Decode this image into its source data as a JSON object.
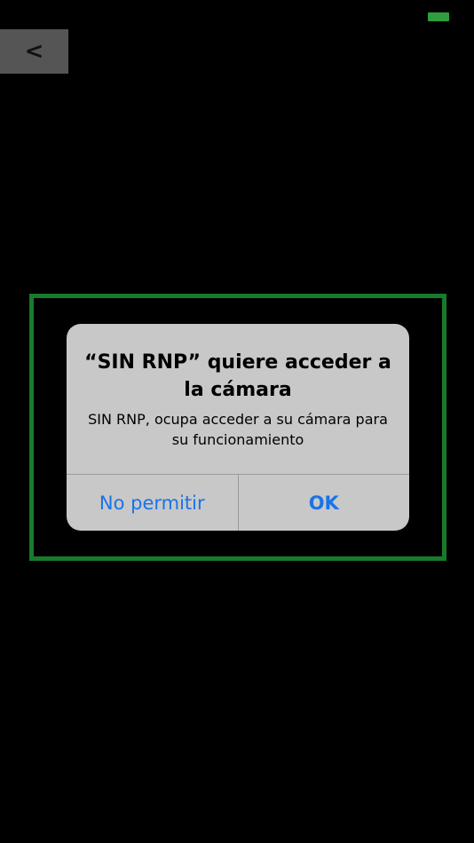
{
  "status_bar": {
    "battery_color": "#2e9e3e"
  },
  "nav": {
    "back_label": "<"
  },
  "scan_frame": {
    "color": "#1a7a2c"
  },
  "alert": {
    "title": "“SIN RNP” quiere acceder a la cámara",
    "message": "SIN RNP, ocupa acceder a su cámara para su funcionamiento",
    "deny_label": "No permitir",
    "ok_label": "OK",
    "button_color": "#1a73e8"
  }
}
